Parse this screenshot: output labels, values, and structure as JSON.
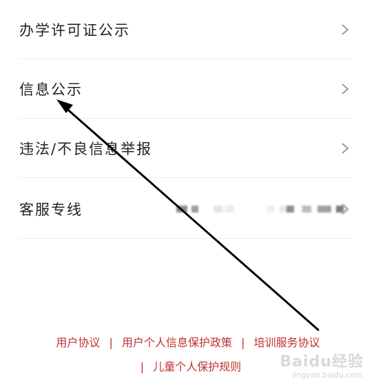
{
  "menu": {
    "items": [
      {
        "label": "办学许可证公示"
      },
      {
        "label": "信息公示"
      },
      {
        "label": "违法/不良信息举报"
      },
      {
        "label": "客服专线"
      }
    ]
  },
  "footer": {
    "links": [
      {
        "label": "用户协议"
      },
      {
        "label": "用户个人信息保护政策"
      },
      {
        "label": "培训服务协议"
      },
      {
        "label": "儿童个人保护规则"
      }
    ],
    "separator": "|"
  },
  "watermark": {
    "brand": "Baidu经验",
    "site": "jingyan.baidu.com"
  },
  "colors": {
    "footer_link": "#c0302f",
    "label": "#222222",
    "divider": "#ececec",
    "chevron": "#9a9a9a",
    "annotation_arrow": "#000000"
  }
}
